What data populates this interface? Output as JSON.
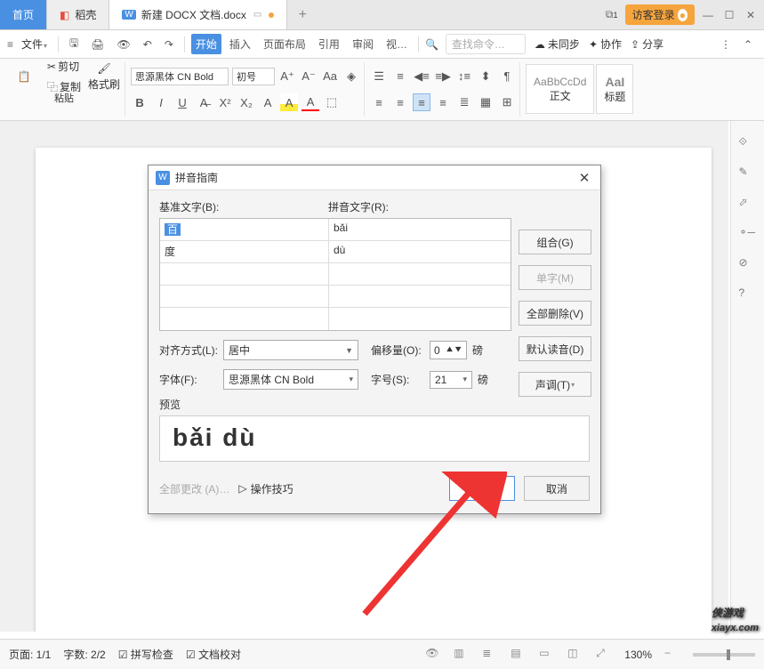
{
  "titlebar": {
    "home": "首页",
    "shell": "稻壳",
    "doc": "新建 DOCX 文档.docx",
    "login": "访客登录"
  },
  "menubar": {
    "file": "文件",
    "start": "开始",
    "insert": "插入",
    "layout": "页面布局",
    "ref": "引用",
    "review": "审阅",
    "view": "视…",
    "search_ph": "查找命令…",
    "sync": "未同步",
    "coop": "协作",
    "share": "分享"
  },
  "ribbon": {
    "paste": "粘贴",
    "cut": "剪切",
    "copy": "复制",
    "fmtpaint": "格式刷",
    "font": "思源黑体 CN Bold",
    "size": "初号",
    "style_normal_sample": "AaBbCcDd",
    "style_normal": "正文",
    "style_h1_sample": "AaI",
    "style_h1": "标题"
  },
  "dialog": {
    "title": "拼音指南",
    "base_label": "基准文字(B):",
    "pinyin_label": "拼音文字(R):",
    "rows": [
      {
        "base": "百",
        "pinyin": "bǎi"
      },
      {
        "base": "度",
        "pinyin": "dù"
      },
      {
        "base": "",
        "pinyin": ""
      },
      {
        "base": "",
        "pinyin": ""
      },
      {
        "base": "",
        "pinyin": ""
      }
    ],
    "combine": "组合(G)",
    "single": "单字(M)",
    "clearall": "全部删除(V)",
    "default": "默认读音(D)",
    "tone": "声调(T)",
    "align_label": "对齐方式(L):",
    "align_val": "居中",
    "offset_label": "偏移量(O):",
    "offset_val": "0",
    "unit": "磅",
    "font_label": "字体(F):",
    "font_val": "思源黑体 CN Bold",
    "fontsize_label": "字号(S):",
    "fontsize_val": "21",
    "preview_label": "预览",
    "preview_text": "bǎi  dù",
    "changeall": "全部更改 (A)…",
    "tips": "操作技巧",
    "ok": "确定",
    "cancel": "取消"
  },
  "statusbar": {
    "page": "页面: 1/1",
    "words": "字数: 2/2",
    "spell": "拼写检查",
    "proof": "文档校对",
    "zoom": "130%"
  },
  "watermark": {
    "brand": "侠游戏",
    "url": "xiayx.com"
  }
}
